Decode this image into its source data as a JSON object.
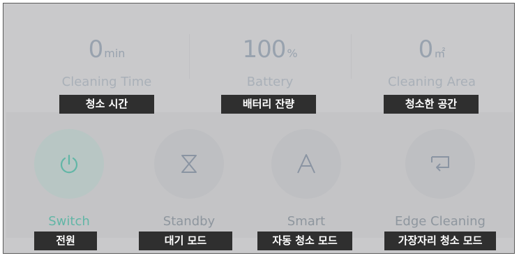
{
  "stats": [
    {
      "value": "0",
      "unit": "min",
      "label": "Cleaning Time",
      "tag": "청소 시간"
    },
    {
      "value": "100",
      "unit": "%",
      "label": "Battery",
      "tag": "배터리 잔량"
    },
    {
      "value": "0",
      "unit": "㎡",
      "label": "Cleaning Area",
      "tag": "청소한 공간"
    }
  ],
  "modes": [
    {
      "label": "Switch",
      "tag": "전원",
      "icon": "power-icon",
      "active": true
    },
    {
      "label": "Standby",
      "tag": "대기 모드",
      "icon": "hourglass-icon",
      "active": false
    },
    {
      "label": "Smart",
      "tag": "자동 청소 모드",
      "icon": "letter-a-icon",
      "active": false
    },
    {
      "label": "Edge Cleaning",
      "tag": "가장자리 청소 모드",
      "icon": "edge-return-icon",
      "active": false
    }
  ],
  "colors": {
    "accent": "#62b6a6",
    "icon": "#8a94a2",
    "tag_bg": "#2f2f2f"
  }
}
